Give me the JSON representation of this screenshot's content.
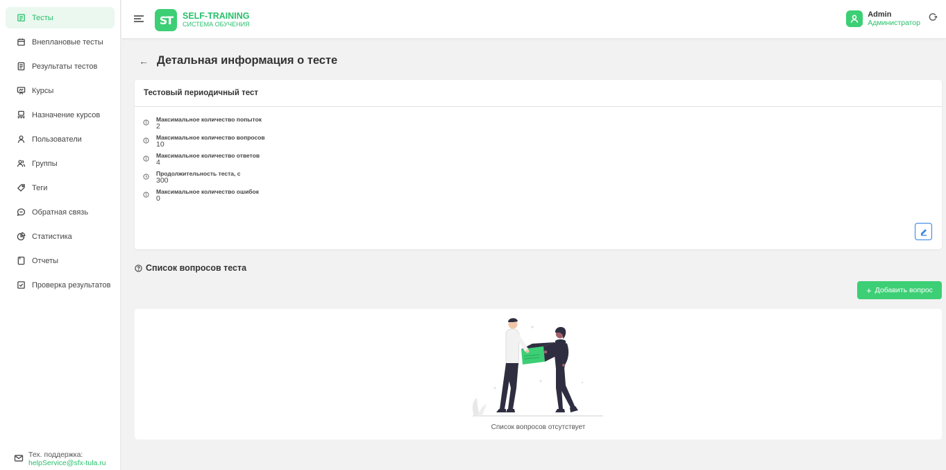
{
  "sidebar": {
    "items": [
      {
        "label": "Тесты",
        "icon": "test-icon",
        "active": true
      },
      {
        "label": "Внеплановые тесты",
        "icon": "calendar-icon",
        "active": false
      },
      {
        "label": "Результаты тестов",
        "icon": "results-icon",
        "active": false
      },
      {
        "label": "Курсы",
        "icon": "presentation-icon",
        "active": false
      },
      {
        "label": "Назначение курсов",
        "icon": "assign-icon",
        "active": false
      },
      {
        "label": "Пользователи",
        "icon": "users-icon",
        "active": false
      },
      {
        "label": "Группы",
        "icon": "groups-icon",
        "active": false
      },
      {
        "label": "Теги",
        "icon": "tag-icon",
        "active": false
      },
      {
        "label": "Обратная связь",
        "icon": "chat-icon",
        "active": false
      },
      {
        "label": "Статистика",
        "icon": "pie-chart-icon",
        "active": false
      },
      {
        "label": "Отчеты",
        "icon": "report-icon",
        "active": false
      },
      {
        "label": "Проверка результатов",
        "icon": "checkbox-icon",
        "active": false
      }
    ],
    "support": {
      "label": "Тех. поддержка:",
      "email": "helpService@sfx-tula.ru"
    }
  },
  "header": {
    "logo_mark": "ST",
    "logo_title": "SELF-TRAINING",
    "logo_subtitle": "СИСТЕМА ОБУЧЕНИЯ",
    "user_name": "Admin",
    "user_role": "Администратор"
  },
  "page": {
    "title": "Детальная информация о тесте",
    "back_glyph": "←"
  },
  "test_card": {
    "name": "Тестовый периодичный тест",
    "properties": [
      {
        "label": "Максимальное количество попыток",
        "value": "2",
        "icon": "info-icon"
      },
      {
        "label": "Максимальное количество вопросов",
        "value": "10",
        "icon": "info-icon"
      },
      {
        "label": "Максимальное количество ответов",
        "value": "4",
        "icon": "info-icon"
      },
      {
        "label": "Продолжительность теста, с",
        "value": "300",
        "icon": "clock-icon"
      },
      {
        "label": "Максимальное количество ошибок",
        "value": "0",
        "icon": "info-icon"
      }
    ]
  },
  "questions": {
    "title": "Список вопросов теста",
    "add_label": "Добавить вопрос",
    "empty_text": "Список вопросов отсутствует"
  },
  "colors": {
    "accent": "#3ccf75",
    "accent_text": "#27c06b",
    "edit_blue": "#2f7fe0",
    "active_bg": "#eaf8ef",
    "background": "#f2f2f2"
  }
}
